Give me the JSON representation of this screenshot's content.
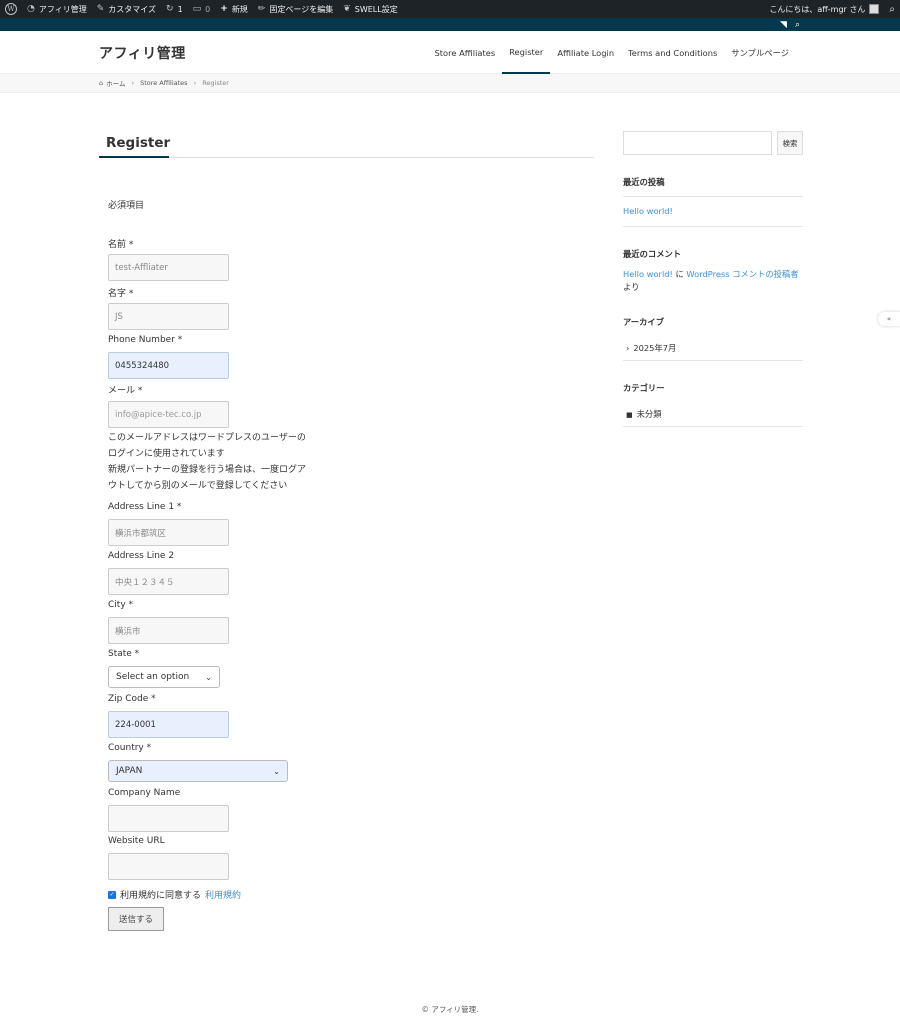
{
  "adminbar": {
    "site": "アフィリ管理",
    "customize": "カスタマイズ",
    "updates": "1",
    "comments": "0",
    "new": "新規",
    "edit": "固定ページを編集",
    "swell": "SWELL設定",
    "greeting": "こんにちは、aff-mgr さん"
  },
  "header": {
    "title": "アフィリ管理",
    "nav": [
      "Store Affiliates",
      "Register",
      "Affiliate Login",
      "Terms and Conditions",
      "サンプルページ"
    ]
  },
  "breadcrumb": {
    "home": "ホーム",
    "parent": "Store Affiliates",
    "current": "Register"
  },
  "main": {
    "title": "Register",
    "required_note": "必須項目",
    "fields": {
      "first_name_label": "名前 *",
      "first_name_value": "test-Affliater",
      "last_name_label": "名字 *",
      "last_name_value": "JS",
      "phone_label": "Phone Number *",
      "phone_value": "0455324480",
      "email_label": "メール *",
      "email_value": "info@apice-tec.co.jp",
      "email_note_1": "このメールアドレスはワードプレスのユーザーのログインに使用されています",
      "email_note_2": "新規パートナーの登録を行う場合は、一度ログアウトしてから別のメールで登録してください",
      "address1_label": "Address Line 1 *",
      "address1_value": "横浜市都筑区",
      "address2_label": "Address Line 2",
      "address2_value": "中央１２３４５",
      "city_label": "City *",
      "city_value": "横浜市",
      "state_label": "State *",
      "state_value": "Select an option",
      "zip_label": "Zip Code *",
      "zip_value": "224-0001",
      "country_label": "Country *",
      "country_value": "JAPAN",
      "company_label": "Company Name",
      "company_value": "",
      "website_label": "Website URL",
      "website_value": ""
    },
    "agree_text": "利用規約に同意する",
    "agree_link": "利用規約",
    "submit": "送信する"
  },
  "sidebar": {
    "search_button": "検索",
    "recent_posts_title": "最近の投稿",
    "recent_post": "Hello world!",
    "recent_comments_title": "最近のコメント",
    "comment_post": "Hello world!",
    "comment_mid": " に ",
    "comment_author": "WordPress コメントの投稿者",
    "comment_tail": " より",
    "archives_title": "アーカイブ",
    "archive_item": "2025年7月",
    "categories_title": "カテゴリー",
    "category_item": "未分類"
  },
  "footer": {
    "copyright": "© アフィリ管理."
  }
}
